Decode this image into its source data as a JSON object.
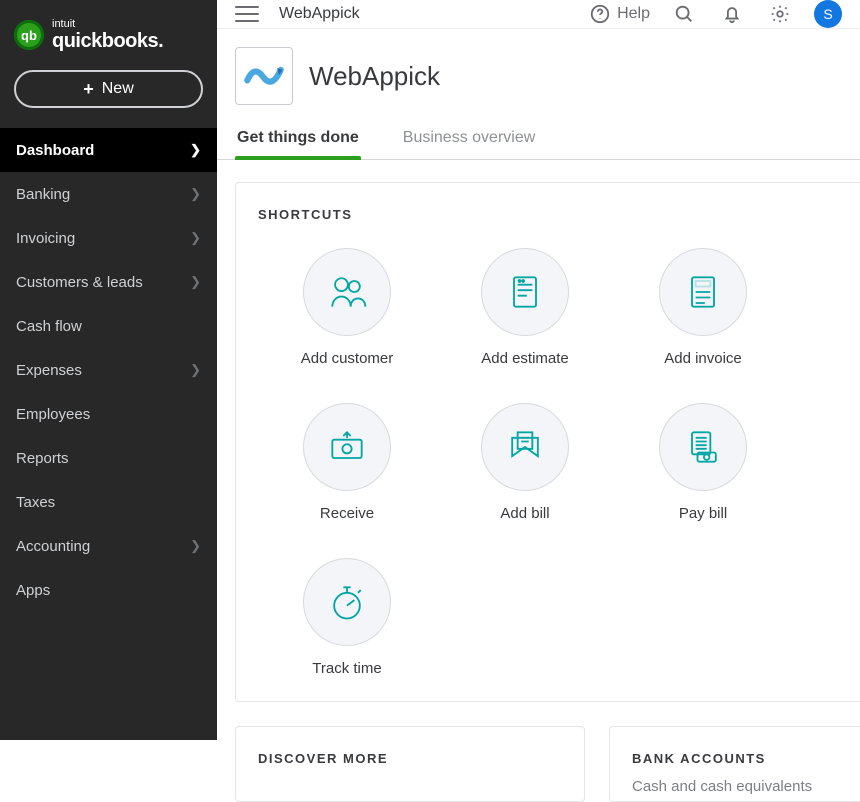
{
  "brand": {
    "parent": "intuit",
    "name": "quickbooks.",
    "mark": "qb"
  },
  "sidebar": {
    "new_label": "New",
    "items": [
      {
        "label": "Dashboard",
        "chevron": true,
        "active": true
      },
      {
        "label": "Banking",
        "chevron": true,
        "active": false
      },
      {
        "label": "Invoicing",
        "chevron": true,
        "active": false
      },
      {
        "label": "Customers & leads",
        "chevron": true,
        "active": false
      },
      {
        "label": "Cash flow",
        "chevron": false,
        "active": false
      },
      {
        "label": "Expenses",
        "chevron": true,
        "active": false
      },
      {
        "label": "Employees",
        "chevron": false,
        "active": false
      },
      {
        "label": "Reports",
        "chevron": false,
        "active": false
      },
      {
        "label": "Taxes",
        "chevron": false,
        "active": false
      },
      {
        "label": "Accounting",
        "chevron": true,
        "active": false
      },
      {
        "label": "Apps",
        "chevron": false,
        "active": false
      }
    ]
  },
  "topbar": {
    "title": "WebAppick",
    "help_label": "Help",
    "avatar_initial": "S"
  },
  "company": {
    "name": "WebAppick"
  },
  "tabs": [
    {
      "label": "Get things done",
      "active": true
    },
    {
      "label": "Business overview",
      "active": false
    }
  ],
  "shortcuts": {
    "heading": "SHORTCUTS",
    "items": [
      {
        "label": "Add customer",
        "icon": "people"
      },
      {
        "label": "Add estimate",
        "icon": "estimate"
      },
      {
        "label": "Add invoice",
        "icon": "invoice"
      },
      {
        "label": "Receive",
        "icon": "receive"
      },
      {
        "label": "Add bill",
        "icon": "bill"
      },
      {
        "label": "Pay bill",
        "icon": "paybill"
      },
      {
        "label": "Track time",
        "icon": "stopwatch"
      }
    ]
  },
  "discover": {
    "heading": "DISCOVER MORE"
  },
  "bank": {
    "heading": "BANK ACCOUNTS",
    "subtext": "Cash and cash equivalents"
  }
}
